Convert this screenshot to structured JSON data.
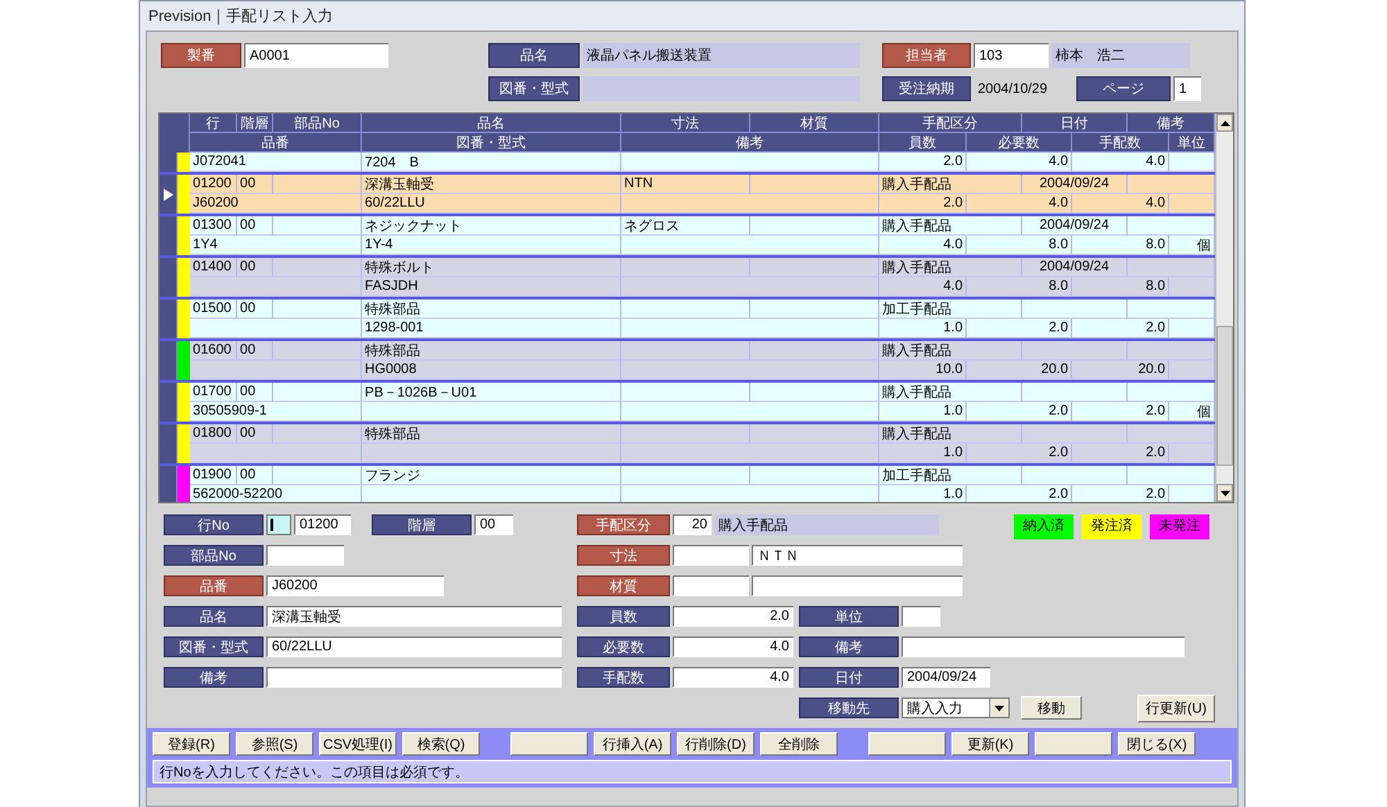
{
  "window": {
    "title": "Prevision｜手配リスト入力"
  },
  "header": {
    "rows": [
      [
        {
          "label": "製番",
          "required": true,
          "fields": [
            {
              "kind": "input",
              "value": "A0001"
            }
          ]
        },
        {
          "label": "品名",
          "required": false,
          "fields": [
            {
              "kind": "display",
              "value": "液晶パネル搬送装置"
            }
          ]
        },
        {
          "label": "担当者",
          "required": true,
          "fields": [
            {
              "kind": "input",
              "value": "103"
            },
            {
              "kind": "display",
              "value": "柿本　浩二"
            }
          ]
        }
      ],
      [
        "",
        {
          "label": "図番・型式",
          "required": false,
          "fields": [
            {
              "kind": "display"
            }
          ]
        },
        {
          "label": "受注納期",
          "required": false,
          "fields": [
            {
              "kind": "plain",
              "value": "2004/10/29"
            }
          ]
        },
        {
          "label": "ページ",
          "required": false,
          "fields": [
            {
              "kind": "input",
              "value": "1"
            }
          ]
        }
      ]
    ]
  },
  "grid": {
    "header_line1": [
      "行",
      "階層",
      "部品No",
      "品名",
      "寸法",
      "材質",
      "手配区分",
      "日付",
      "備考"
    ],
    "header_line2": [
      "品番",
      "図番・型式",
      "備考",
      "員数",
      "必要数",
      "手配数",
      "単位"
    ],
    "records": [
      {
        "selected": false,
        "color": "#ffff00",
        "line2": {
          "item_no": "J072041",
          "drawing": "7204　B",
          "qty_per": "2.0",
          "required": "4.0",
          "order_qty": "4.0"
        }
      },
      {
        "selected": true,
        "color": "#ffff00",
        "line1": {
          "row_no": "01200",
          "level": "00",
          "name": "深溝玉軸受",
          "size": "NTN",
          "arrangement": "購入手配品",
          "date": "2004/09/24"
        },
        "line2": {
          "item_no": "J60200",
          "drawing": "60/22LLU",
          "qty_per": "2.0",
          "required": "4.0",
          "order_qty": "4.0"
        }
      },
      {
        "selected": false,
        "color": "#ffff00",
        "line1": {
          "row_no": "01300",
          "level": "00",
          "name": "ネジックナット",
          "size": "ネグロス",
          "arrangement": "購入手配品",
          "date": "2004/09/24"
        },
        "line2": {
          "item_no": "1Y4",
          "drawing": "1Y-4",
          "qty_per": "4.0",
          "required": "8.0",
          "order_qty": "8.0",
          "unit": "個"
        }
      },
      {
        "selected": false,
        "color": "#ffff00",
        "line1": {
          "row_no": "01400",
          "level": "00",
          "name": "特殊ボルト",
          "arrangement": "購入手配品",
          "date": "2004/09/24"
        },
        "line2": {
          "drawing": "FASJDH",
          "qty_per": "4.0",
          "required": "8.0",
          "order_qty": "8.0"
        }
      },
      {
        "selected": false,
        "color": "#ffff00",
        "line1": {
          "row_no": "01500",
          "level": "00",
          "name": "特殊部品",
          "arrangement": "加工手配品"
        },
        "line2": {
          "drawing": "1298-001",
          "qty_per": "1.0",
          "required": "2.0",
          "order_qty": "2.0"
        }
      },
      {
        "selected": false,
        "color": "#00ee00",
        "line1": {
          "row_no": "01600",
          "level": "00",
          "name": "特殊部品",
          "arrangement": "購入手配品"
        },
        "line2": {
          "drawing": "HG0008",
          "qty_per": "10.0",
          "required": "20.0",
          "order_qty": "20.0"
        }
      },
      {
        "selected": false,
        "color": "#ffff00",
        "line1": {
          "row_no": "01700",
          "level": "00",
          "name": "PB－1026B－U01",
          "arrangement": "購入手配品"
        },
        "line2": {
          "item_no": "30505909-1",
          "qty_per": "1.0",
          "required": "2.0",
          "order_qty": "2.0",
          "unit": "個"
        }
      },
      {
        "selected": false,
        "color": "#ffff00",
        "line1": {
          "row_no": "01800",
          "level": "00",
          "name": "特殊部品",
          "arrangement": "購入手配品"
        },
        "line2": {
          "qty_per": "1.0",
          "required": "2.0",
          "order_qty": "2.0"
        }
      },
      {
        "selected": false,
        "color": "#ff00ff",
        "line1": {
          "row_no": "01900",
          "level": "00",
          "name": "フランジ",
          "arrangement": "加工手配品"
        },
        "line2": {
          "item_no": "562000-52200",
          "qty_per": "1.0",
          "required": "2.0",
          "order_qty": "2.0"
        }
      }
    ]
  },
  "detail": {
    "legend": [
      {
        "label": "納入済",
        "color": "#00ff00"
      },
      {
        "label": "発注済",
        "color": "#ffff00"
      },
      {
        "label": "未発注",
        "color": "#ff00ff"
      }
    ],
    "rows": [
      [
        {
          "label": "行No",
          "required": false,
          "fields": [
            {
              "kind": "active"
            },
            {
              "kind": "input",
              "value": "01200"
            }
          ]
        },
        {
          "label": "階層",
          "required": false,
          "fields": [
            {
              "kind": "input",
              "value": "00"
            }
          ]
        },
        {
          "label": "手配区分",
          "required": true,
          "fields": [
            {
              "kind": "number",
              "value": "20"
            },
            {
              "kind": "display",
              "value": "購入手配品"
            }
          ]
        }
      ],
      [
        {
          "label": "部品No",
          "required": false,
          "fields": [
            {
              "kind": "input"
            }
          ]
        },
        "",
        {
          "label": "寸法",
          "required": true,
          "fields": [
            {
              "kind": "input"
            },
            {
              "kind": "input",
              "value": "ＮＴＮ"
            }
          ]
        }
      ],
      [
        {
          "label": "品番",
          "required": true,
          "fields": [
            {
              "kind": "input",
              "value": "J60200"
            }
          ]
        },
        "",
        {
          "label": "材質",
          "required": true,
          "fields": [
            {
              "kind": "input"
            },
            {
              "kind": "input"
            }
          ]
        }
      ],
      [
        {
          "label": "品名",
          "required": false,
          "fields": [
            {
              "kind": "input",
              "value": "深溝玉軸受"
            }
          ]
        },
        "",
        {
          "label": "員数",
          "required": false,
          "fields": [
            {
              "kind": "number",
              "value": "2.0"
            }
          ]
        },
        {
          "label": "単位",
          "required": false,
          "fields": [
            {
              "kind": "input"
            }
          ]
        }
      ],
      [
        {
          "label": "図番・型式",
          "required": false,
          "fields": [
            {
              "kind": "input",
              "value": "60/22LLU"
            }
          ]
        },
        "",
        {
          "label": "必要数",
          "required": false,
          "fields": [
            {
              "kind": "number",
              "value": "4.0"
            }
          ]
        },
        {
          "label": "備考",
          "required": false,
          "fields": [
            {
              "kind": "input"
            }
          ]
        }
      ],
      [
        {
          "label": "備考",
          "required": false,
          "fields": [
            {
              "kind": "input"
            }
          ]
        },
        "",
        {
          "label": "手配数",
          "required": false,
          "fields": [
            {
              "kind": "number",
              "value": "4.0"
            }
          ]
        },
        {
          "label": "日付",
          "required": false,
          "fields": [
            {
              "kind": "input",
              "value": "2004/09/24"
            }
          ]
        }
      ],
      [
        "",
        "",
        "",
        {
          "label": "移動先",
          "required": false,
          "fields": [
            {
              "kind": "select",
              "value": "購入入力"
            }
          ]
        }
      ]
    ],
    "move_button": "移動",
    "update_button": "行更新(U)"
  },
  "toolbar": {
    "groups": [
      [
        {
          "kind": "button",
          "label": "登録(R)"
        },
        {
          "kind": "button",
          "label": "参照(S)"
        },
        {
          "kind": "button",
          "label": "CSV処理(I)"
        },
        {
          "kind": "button",
          "label": "検索(Q)"
        }
      ],
      [
        {
          "kind": "blank"
        },
        {
          "kind": "button",
          "label": "行挿入(A)"
        },
        {
          "kind": "button",
          "label": "行削除(D)"
        },
        {
          "kind": "button",
          "label": "全削除"
        }
      ],
      [
        {
          "kind": "blank"
        },
        {
          "kind": "button",
          "label": "更新(K)"
        },
        {
          "kind": "blank"
        },
        {
          "kind": "button",
          "label": "閉じる(X)"
        }
      ]
    ]
  },
  "status_bar": {
    "message": "行Noを入力してください。この項目は必須です。"
  }
}
